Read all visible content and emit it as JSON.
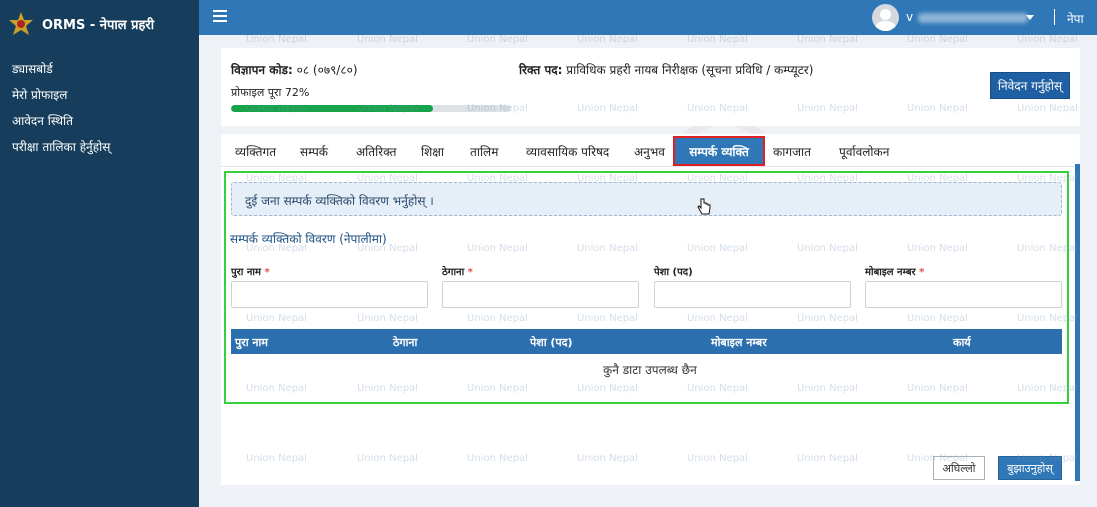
{
  "app": {
    "title": "ORMS - नेपाल प्रहरी"
  },
  "sidebar": {
    "items": [
      {
        "label": "ड्यासबोर्ड"
      },
      {
        "label": "मेरो प्रोफाइल"
      },
      {
        "label": "आवेदन स्थिति"
      },
      {
        "label": "परीक्षा तालिका हेर्नुहोस्"
      }
    ]
  },
  "topbar": {
    "user_initial": "v",
    "lang": "नेपा"
  },
  "summary": {
    "adv_code_label": "विज्ञापन कोड:",
    "adv_code_value": "०८ (०७९/८०)",
    "post_label": "रिक्त पद:",
    "post_value": "प्राविधिक प्रहरी नायब निरीक्षक (सूचना प्रविधि / कम्प्यूटर)",
    "profile_text": "प्रोफाइल पूरा 72%",
    "profile_percent": 72,
    "apply_button": "निवेदन गर्नुहोस्"
  },
  "tabs": [
    {
      "label": "व्यक्तिगत"
    },
    {
      "label": "सम्पर्क"
    },
    {
      "label": "अतिरिक्त"
    },
    {
      "label": "शिक्षा"
    },
    {
      "label": "तालिम"
    },
    {
      "label": "व्यावसायिक परिषद"
    },
    {
      "label": "अनुभव"
    },
    {
      "label": "सम्पर्क व्यक्ति"
    },
    {
      "label": "कागजात"
    },
    {
      "label": "पूर्वावलोकन"
    }
  ],
  "form": {
    "info": "दुई जना सम्पर्क व्यक्तिको विवरण भर्नुहोस् ।",
    "section_title": "सम्पर्क व्यक्तिको विवरण (नेपालीमा)",
    "fields": [
      {
        "label": "पुरा नाम",
        "required": "*"
      },
      {
        "label": "ठेगाना",
        "required": "*"
      },
      {
        "label": "पेशा (पद)",
        "required": ""
      },
      {
        "label": "मोबाइल नम्बर",
        "required": "*"
      }
    ]
  },
  "table": {
    "columns": [
      "पुरा नाम",
      "ठेगाना",
      "पेशा (पद)",
      "मोबाइल नम्बर",
      "कार्य"
    ],
    "empty": "कुनै डाटा उपलब्ध छैन"
  },
  "actions": {
    "prev": "अघिल्लो",
    "submit": "बुझाउनुहोस्"
  },
  "watermark": "Union Nepal"
}
